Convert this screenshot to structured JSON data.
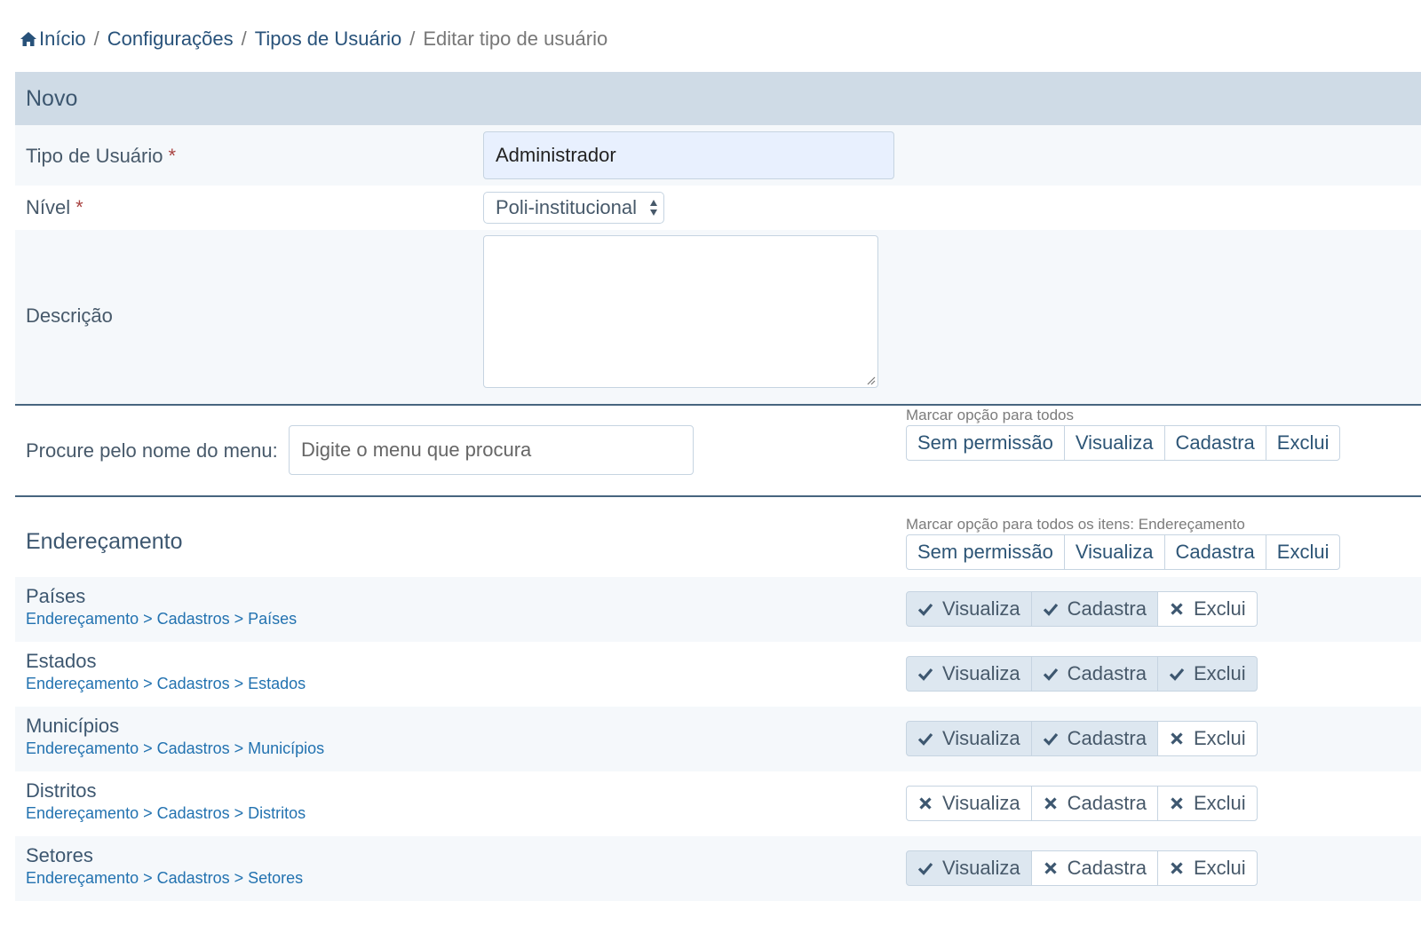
{
  "breadcrumb": {
    "items": [
      "Início",
      "Configurações",
      "Tipos de Usuário"
    ],
    "current": "Editar tipo de usuário"
  },
  "panel": {
    "title": "Novo"
  },
  "form": {
    "tipo": {
      "label": "Tipo de Usuário",
      "value": "Administrador"
    },
    "nivel": {
      "label": "Nível",
      "value": "Poli-institucional"
    },
    "descricao": {
      "label": "Descrição",
      "value": ""
    },
    "required_marker": "*"
  },
  "search": {
    "label": "Procure pelo nome do menu:",
    "placeholder": "Digite o menu que procura"
  },
  "mark_all": {
    "caption": "Marcar opção para todos",
    "options": [
      "Sem permissão",
      "Visualiza",
      "Cadastra",
      "Exclui"
    ]
  },
  "sections": [
    {
      "title": "Endereçamento",
      "mark_caption": "Marcar opção para todos os itens: Endereçamento",
      "options": [
        "Sem permissão",
        "Visualiza",
        "Cadastra",
        "Exclui"
      ],
      "items": [
        {
          "title": "Países",
          "path": "Endereçamento > Cadastros > Países",
          "perms": [
            {
              "label": "Visualiza",
              "on": true
            },
            {
              "label": "Cadastra",
              "on": true
            },
            {
              "label": "Exclui",
              "on": false
            }
          ]
        },
        {
          "title": "Estados",
          "path": "Endereçamento > Cadastros > Estados",
          "perms": [
            {
              "label": "Visualiza",
              "on": true
            },
            {
              "label": "Cadastra",
              "on": true
            },
            {
              "label": "Exclui",
              "on": true
            }
          ]
        },
        {
          "title": "Municípios",
          "path": "Endereçamento > Cadastros > Municípios",
          "perms": [
            {
              "label": "Visualiza",
              "on": true
            },
            {
              "label": "Cadastra",
              "on": true
            },
            {
              "label": "Exclui",
              "on": false
            }
          ]
        },
        {
          "title": "Distritos",
          "path": "Endereçamento > Cadastros > Distritos",
          "perms": [
            {
              "label": "Visualiza",
              "on": false
            },
            {
              "label": "Cadastra",
              "on": false
            },
            {
              "label": "Exclui",
              "on": false
            }
          ]
        },
        {
          "title": "Setores",
          "path": "Endereçamento > Cadastros > Setores",
          "perms": [
            {
              "label": "Visualiza",
              "on": true
            },
            {
              "label": "Cadastra",
              "on": false
            },
            {
              "label": "Exclui",
              "on": false
            }
          ]
        }
      ]
    }
  ],
  "colors": {
    "heading_bg": "#cfdbe6",
    "accent": "#28527a",
    "link": "#2272b0",
    "active_perm": "#dde7f0"
  }
}
